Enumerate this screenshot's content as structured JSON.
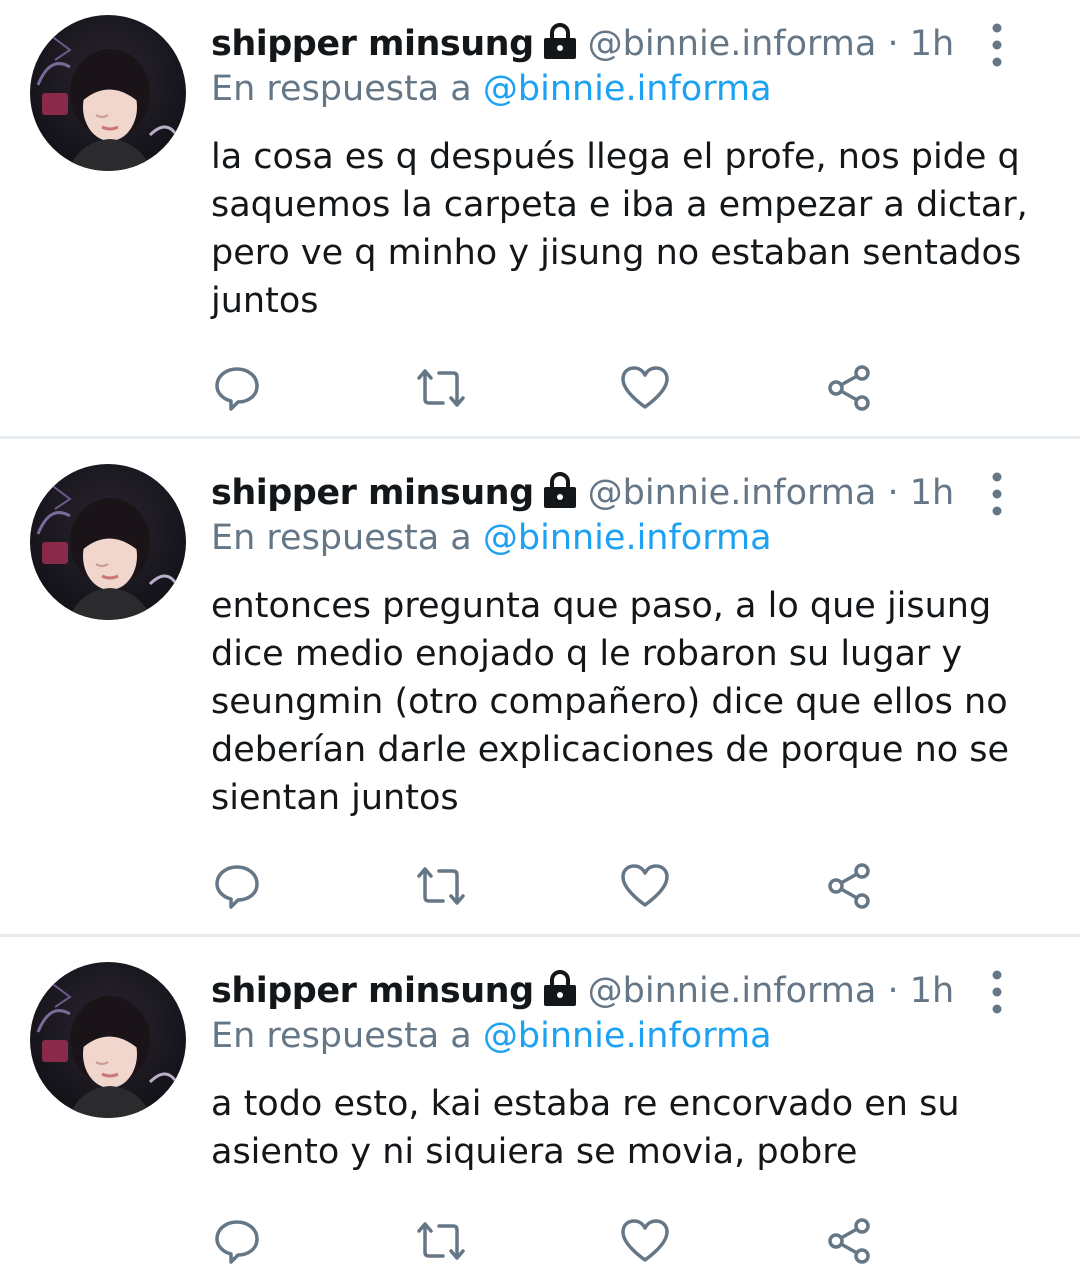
{
  "tweets": [
    {
      "name": "shipper minsung",
      "handle": "@binnie.informa",
      "separator": "·",
      "time": "1h",
      "reply_prefix": "En respuesta a",
      "reply_mention": "@binnie.informa",
      "text": "la cosa es q después llega el profe, nos pide q saquemos la carpeta e iba a empezar a dictar, pero ve q minho y jisung no estaban sentados juntos"
    },
    {
      "name": "shipper minsung",
      "handle": "@binnie.informa",
      "separator": "·",
      "time": "1h",
      "reply_prefix": "En respuesta a",
      "reply_mention": "@binnie.informa",
      "text": "entonces pregunta que paso, a lo que jisung dice medio enojado q le robaron su lugar y seungmin (otro compañero) dice que ellos no deberían darle explicaciones de porque no se sientan juntos"
    },
    {
      "name": "shipper minsung",
      "handle": "@binnie.informa",
      "separator": "·",
      "time": "1h",
      "reply_prefix": "En respuesta a",
      "reply_mention": "@binnie.informa",
      "text": "a todo esto, kai estaba re encorvado en su asiento y ni siquiera se movia, pobre"
    }
  ],
  "icons": {
    "reply": "speech-bubble-icon",
    "retweet": "retweet-arrows-icon",
    "like": "heart-icon",
    "share": "share-nodes-icon",
    "more": "vertical-dots-icon",
    "protected": "lock-icon"
  },
  "colors": {
    "text": "#14171a",
    "secondary": "#657786",
    "link": "#1da1f2",
    "divider": "#e6ecf0"
  }
}
